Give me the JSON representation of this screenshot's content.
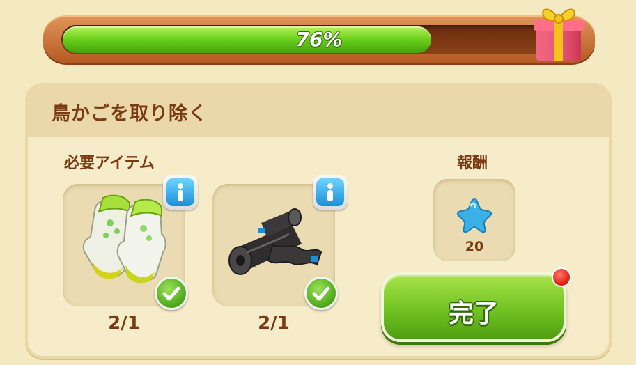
{
  "progress": {
    "percent_label": "76%",
    "value": 0.76,
    "fill_color": "#6fd21e"
  },
  "task": {
    "title": "鳥かごを取り除く"
  },
  "required_items": {
    "label": "必要アイテム",
    "items": [
      {
        "name": "gardening-gloves",
        "count_label": "2/1",
        "completed": true
      },
      {
        "name": "garbage-bags",
        "count_label": "2/1",
        "completed": true
      }
    ]
  },
  "reward": {
    "label": "報酬",
    "icon": "blue-star-icon",
    "amount": "20"
  },
  "complete_button": {
    "label": "完了",
    "has_notification": true
  },
  "colors": {
    "brand_text": "#7a3a12",
    "button_green": "#75c624",
    "info_blue": "#1a8fd8",
    "notification_red": "#e0180c"
  }
}
